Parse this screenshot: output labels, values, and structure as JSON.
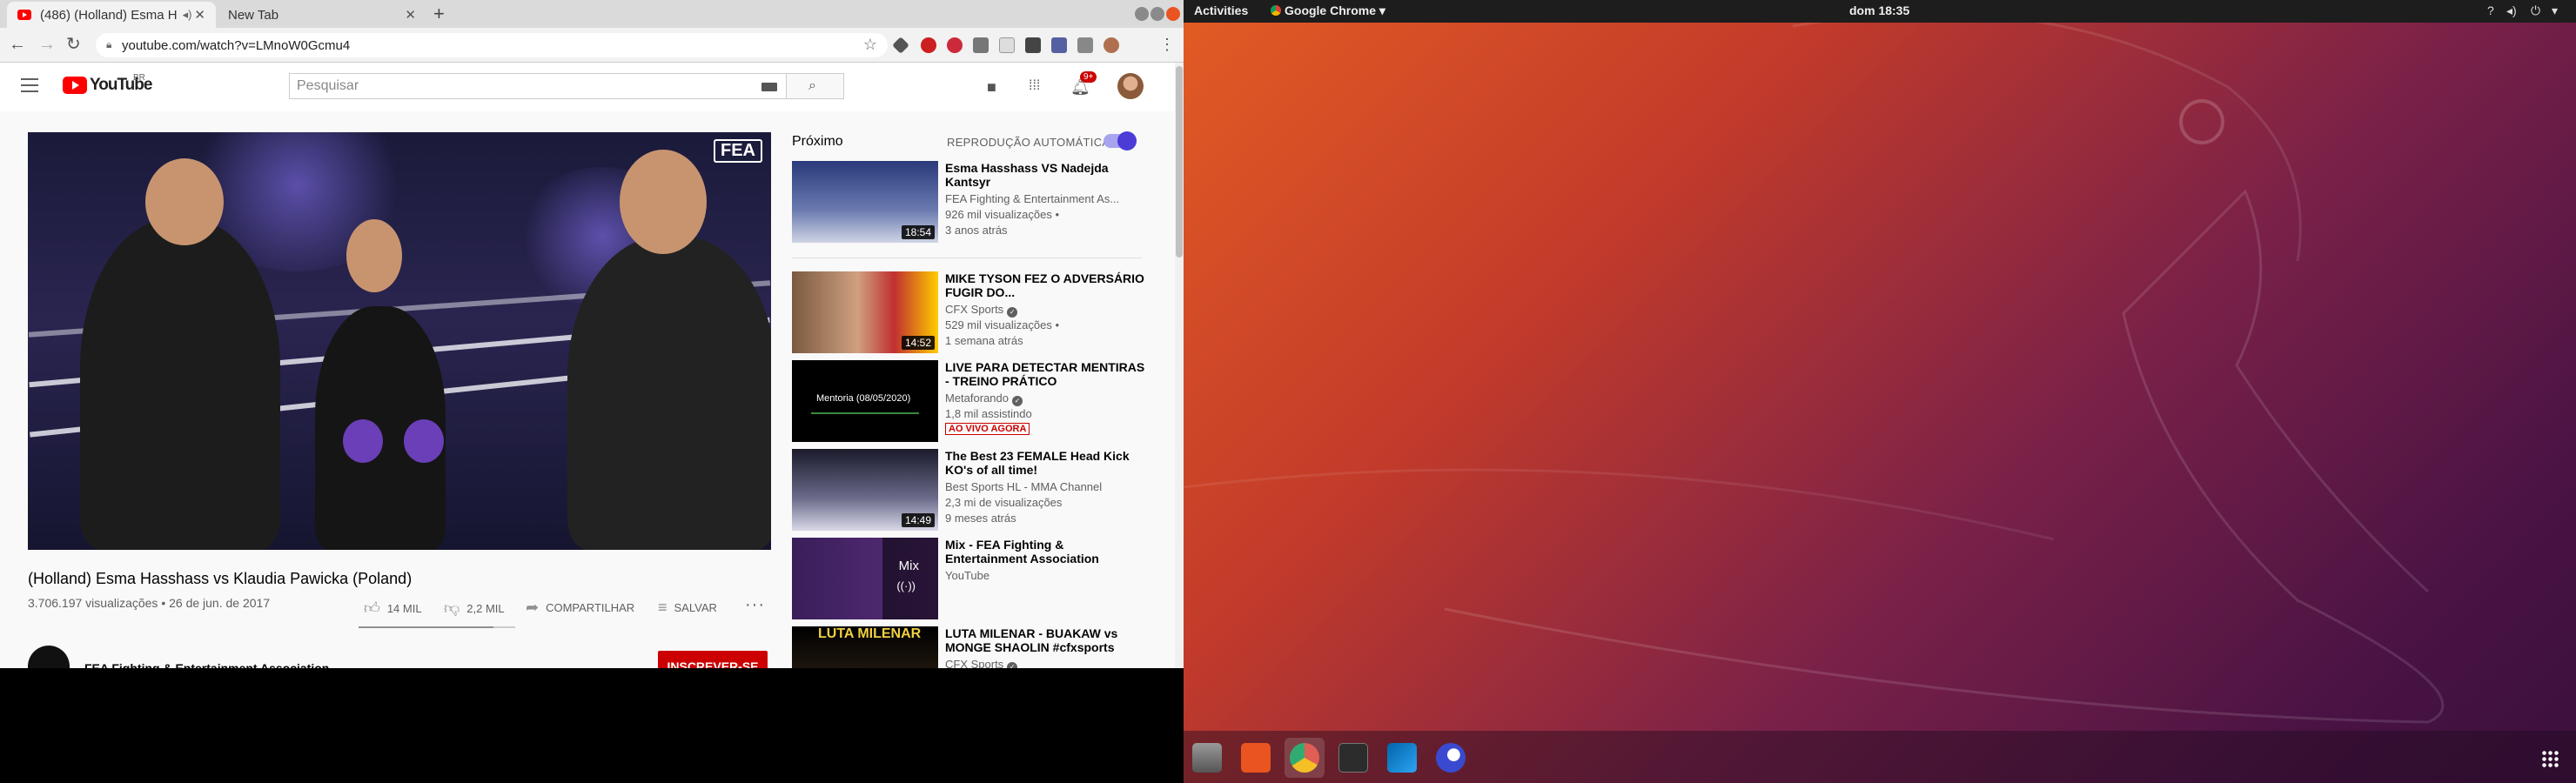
{
  "browser": {
    "tabs": [
      {
        "label": "(486) (Holland) Esma H",
        "active": true
      },
      {
        "label": "New Tab",
        "active": false
      }
    ],
    "url": "youtube.com/watch?v=LMnoW0Gcmu4"
  },
  "youtube": {
    "logo_text": "YouTube",
    "region": "BR",
    "search_placeholder": "Pesquisar",
    "notifications_badge": "9+",
    "video": {
      "watermark": "FEA",
      "title": "(Holland) Esma Hasshass vs Klaudia Pawicka (Poland)",
      "views_date": "3.706.197 visualizações • 26 de jun. de 2017",
      "likes": "14 MIL",
      "dislikes": "2,2 MIL",
      "share_label": "COMPARTILHAR",
      "save_label": "SALVAR",
      "like_ratio": 0.86
    },
    "channel": {
      "name": "FEA Fighting & Entertainment Association",
      "subscribe_label": "INSCREVER-SE"
    },
    "sidebar": {
      "up_next_label": "Próximo",
      "autoplay_label": "REPRODUÇÃO AUTOMÁTICA",
      "autoplay_on": true,
      "recommendations": [
        {
          "title": "Esma Hasshass VS Nadejda Kantsyr",
          "channel": "FEA Fighting & Entertainment As...",
          "verified": false,
          "meta": "926 mil visualizações •",
          "meta2": "3 anos atrás",
          "duration": "18:54"
        },
        {
          "title": "MIKE TYSON FEZ O ADVERSÁRIO FUGIR DO...",
          "channel": "CFX Sports",
          "verified": true,
          "meta": "529 mil visualizações •",
          "meta2": "1 semana atrás",
          "duration": "14:52"
        },
        {
          "title": "LIVE PARA DETECTAR MENTIRAS - TREINO PRÁTICO",
          "channel": "Metaforando",
          "verified": true,
          "meta": "1,8 mil assistindo",
          "live_badge": "AO VIVO AGORA",
          "thumb_text": "Mentoria (08/05/2020)"
        },
        {
          "title": "The Best 23 FEMALE Head Kick KO's of all time!",
          "channel": "Best Sports HL - MMA Channel",
          "verified": false,
          "meta": "2,3 mi de visualizações",
          "meta2": "9 meses atrás",
          "duration": "14:49"
        },
        {
          "title": "Mix - FEA Fighting & Entertainment Association",
          "channel": "YouTube",
          "verified": false,
          "thumb_text": "Mix"
        },
        {
          "title": "LUTA MILENAR - BUAKAW vs MONGE SHAOLIN #cfxsports",
          "channel": "CFX Sports",
          "verified": true,
          "thumb_text": "LUTA MILENAR"
        }
      ]
    }
  },
  "desktop": {
    "activities": "Activities",
    "app_menu": "Google Chrome",
    "clock": "dom 18:35",
    "tray_icons": [
      "help-icon",
      "volume-icon",
      "power-icon"
    ],
    "dock_icons": [
      "files-icon",
      "software-center-icon",
      "chrome-icon",
      "terminal-icon",
      "vscode-icon",
      "app-icon"
    ],
    "accent_color": "#e95420"
  }
}
